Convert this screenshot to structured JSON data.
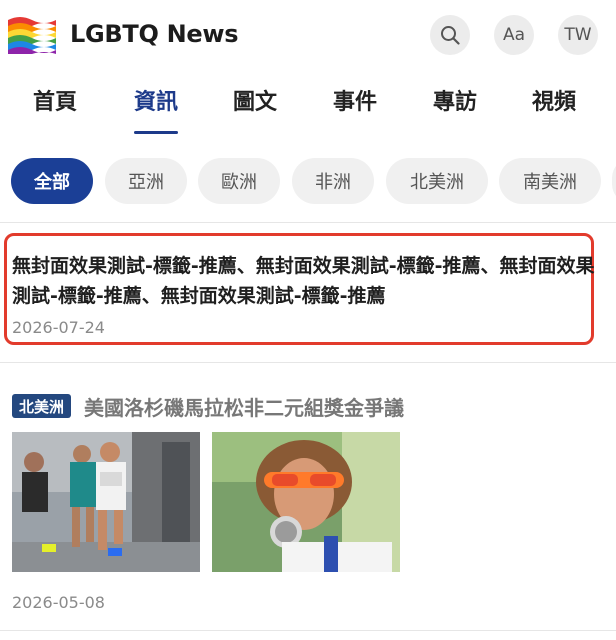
{
  "header": {
    "brand": "LGBTQ News",
    "search_icon": "search-icon",
    "font_button": "Aa",
    "region_button": "TW"
  },
  "nav": {
    "items": [
      "首頁",
      "資訊",
      "圖文",
      "事件",
      "專訪",
      "視頻"
    ],
    "active_index": 1
  },
  "chips": {
    "items": [
      "全部",
      "亞洲",
      "歐洲",
      "非洲",
      "北美洲",
      "南美洲"
    ],
    "active_index": 0
  },
  "articles": [
    {
      "title": "無封面效果測試-標籤-推薦、無封面效果測試-標籤-推薦、無封面效果測試-標籤-推薦、無封面效果測試-標籤-推薦",
      "date": "2026-07-24"
    },
    {
      "badge": "北美洲",
      "title": "美國洛杉磯馬拉松非二元組獎金爭議",
      "date": "2026-05-08"
    }
  ],
  "colors": {
    "accent": "#1d3a8a",
    "chip_active": "#1b3f96",
    "highlight_border": "#e23b2c",
    "badge": "#24487f"
  }
}
